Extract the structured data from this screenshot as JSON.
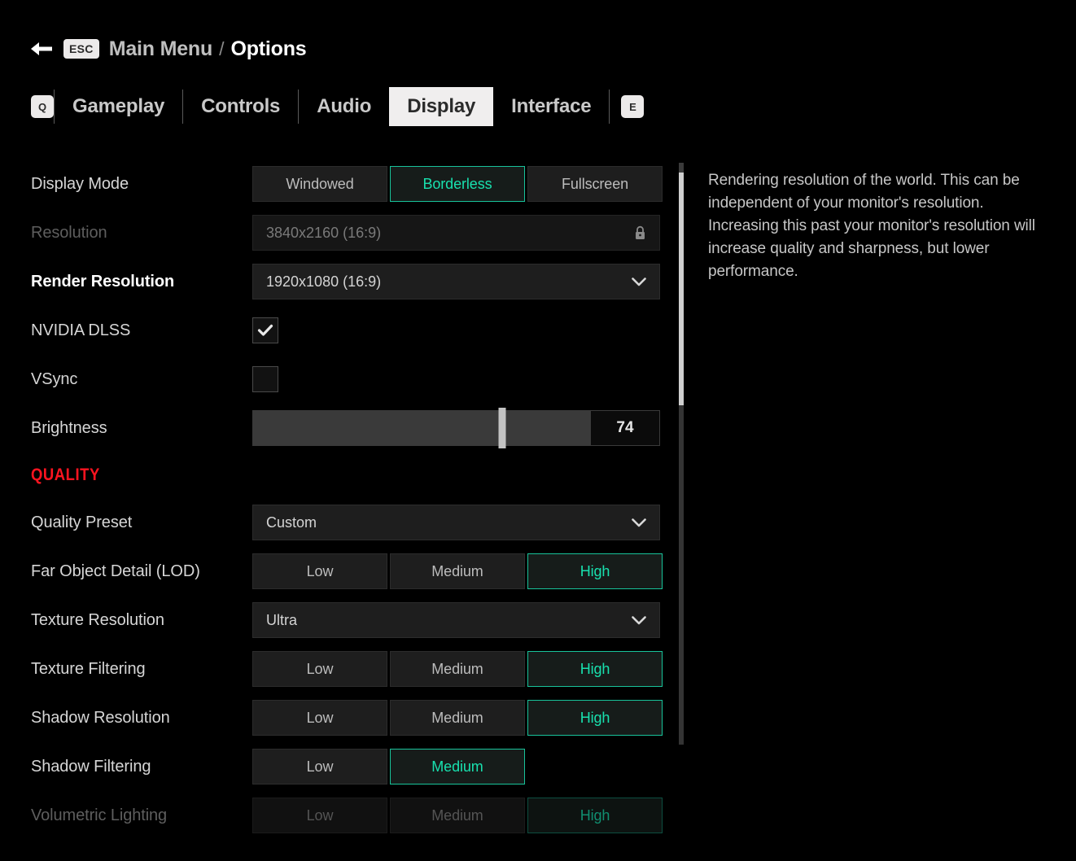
{
  "breadcrumb": {
    "back_icon": "arrow-left-icon",
    "esc_key": "ESC",
    "parent": "Main Menu",
    "separator": "/",
    "current": "Options"
  },
  "tabs": {
    "prev_key": "Q",
    "next_key": "E",
    "items": [
      {
        "label": "Gameplay",
        "active": false
      },
      {
        "label": "Controls",
        "active": false
      },
      {
        "label": "Audio",
        "active": false
      },
      {
        "label": "Display",
        "active": true
      },
      {
        "label": "Interface",
        "active": false
      }
    ]
  },
  "settings": [
    {
      "id": "display-mode",
      "label": "Display Mode",
      "type": "segmented",
      "options": [
        "Windowed",
        "Borderless",
        "Fullscreen"
      ],
      "value": "Borderless",
      "disabled": false,
      "focused": false
    },
    {
      "id": "resolution",
      "label": "Resolution",
      "type": "locked-field",
      "value": "3840x2160 (16:9)",
      "icon": "lock-icon",
      "disabled": true,
      "focused": false
    },
    {
      "id": "render-resolution",
      "label": "Render Resolution",
      "type": "dropdown",
      "value": "1920x1080 (16:9)",
      "icon": "chevron-down-icon",
      "disabled": false,
      "focused": true
    },
    {
      "id": "nvidia-dlss",
      "label": "NVIDIA DLSS",
      "type": "checkbox",
      "value": true,
      "disabled": false,
      "focused": false
    },
    {
      "id": "vsync",
      "label": "VSync",
      "type": "checkbox",
      "value": false,
      "disabled": false,
      "focused": false
    },
    {
      "id": "brightness",
      "label": "Brightness",
      "type": "slider",
      "value": 74,
      "min": 0,
      "max": 100,
      "display_value": "74",
      "disabled": false,
      "focused": false
    }
  ],
  "quality_section": {
    "title": "QUALITY",
    "accent_color": "#ff1420",
    "settings": [
      {
        "id": "quality-preset",
        "label": "Quality Preset",
        "type": "dropdown",
        "value": "Custom",
        "icon": "chevron-down-icon",
        "disabled": false,
        "focused": false
      },
      {
        "id": "far-object-detail",
        "label": "Far Object Detail (LOD)",
        "type": "segmented",
        "options": [
          "Low",
          "Medium",
          "High"
        ],
        "value": "High",
        "disabled": false,
        "focused": false
      },
      {
        "id": "texture-resolution",
        "label": "Texture Resolution",
        "type": "dropdown",
        "value": "Ultra",
        "icon": "chevron-down-icon",
        "disabled": false,
        "focused": false
      },
      {
        "id": "texture-filtering",
        "label": "Texture Filtering",
        "type": "segmented",
        "options": [
          "Low",
          "Medium",
          "High"
        ],
        "value": "High",
        "disabled": false,
        "focused": false
      },
      {
        "id": "shadow-resolution",
        "label": "Shadow Resolution",
        "type": "segmented",
        "options": [
          "Low",
          "Medium",
          "High"
        ],
        "value": "High",
        "disabled": false,
        "focused": false
      },
      {
        "id": "shadow-filtering",
        "label": "Shadow Filtering",
        "type": "segmented",
        "options": [
          "Low",
          "Medium"
        ],
        "value": "Medium",
        "disabled": false,
        "focused": false
      },
      {
        "id": "volumetric-lighting",
        "label": "Volumetric Lighting",
        "type": "segmented",
        "options": [
          "Low",
          "Medium",
          "High"
        ],
        "value": "High",
        "disabled": true,
        "focused": false
      }
    ]
  },
  "description": {
    "text": "Rendering resolution of the world. This can be independent of your monitor's resolution. Increasing this past your monitor's resolution will increase quality and sharpness, but lower performance."
  },
  "scrollbar": {
    "thumb_top_pct": 1.7,
    "thumb_height_pct": 40
  },
  "theme": {
    "background": "#000000",
    "accent_teal": "#18e0ae",
    "accent_red": "#ff1420",
    "panel": "#1e1e1e"
  }
}
